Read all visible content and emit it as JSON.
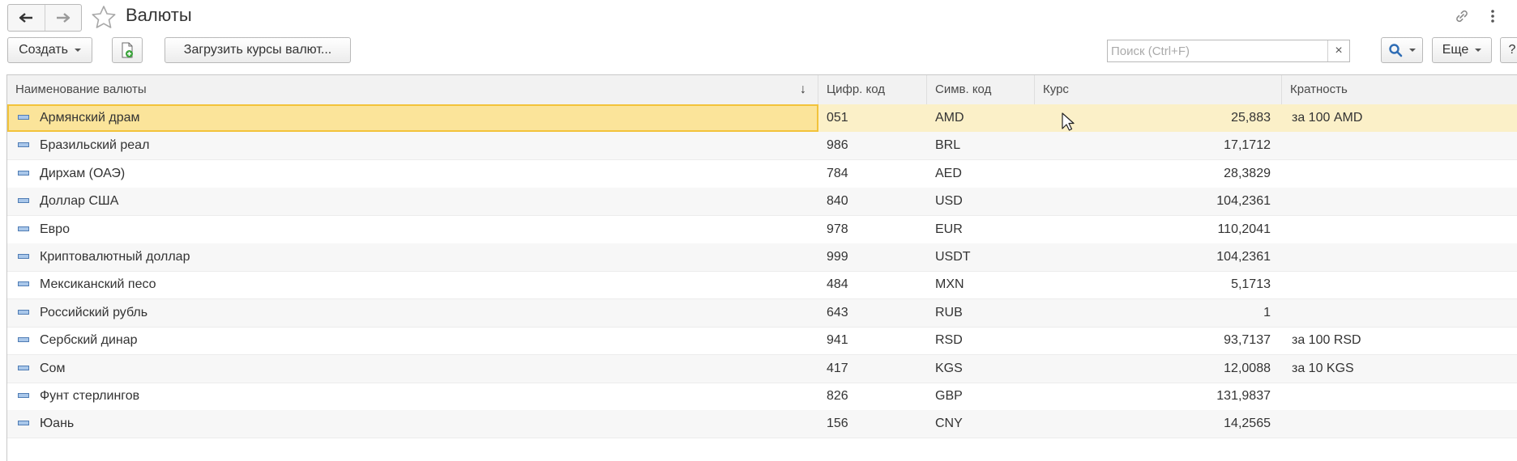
{
  "window": {
    "title": "Валюты"
  },
  "nav": {
    "back_icon": "arrow-left-icon",
    "forward_icon": "arrow-right-icon",
    "favorite_icon": "star-icon"
  },
  "header_icons": {
    "link": "link-icon",
    "more": "kebab-icon"
  },
  "toolbar": {
    "create_label": "Создать",
    "add_copy_icon": "new-document-icon",
    "load_rates_label": "Загрузить курсы валют...",
    "search_placeholder": "Поиск (Ctrl+F)",
    "search_clear": "×",
    "search_icon": "magnifier-icon",
    "more_label": "Еще",
    "help_label": "?"
  },
  "table": {
    "columns": [
      "Наименование валюты",
      "Цифр. код",
      "Симв. код",
      "Курс",
      "Кратность"
    ],
    "sort_indicator": "↓",
    "rows": [
      {
        "name": "Армянский драм",
        "num": "051",
        "sym": "AMD",
        "rate": "25,883",
        "mult": "за 100 AMD",
        "selected": true
      },
      {
        "name": "Бразильский реал",
        "num": "986",
        "sym": "BRL",
        "rate": "17,1712",
        "mult": ""
      },
      {
        "name": "Дирхам (ОАЭ)",
        "num": "784",
        "sym": "AED",
        "rate": "28,3829",
        "mult": ""
      },
      {
        "name": "Доллар США",
        "num": "840",
        "sym": "USD",
        "rate": "104,2361",
        "mult": ""
      },
      {
        "name": "Евро",
        "num": "978",
        "sym": "EUR",
        "rate": "110,2041",
        "mult": ""
      },
      {
        "name": "Криптовалютный доллар",
        "num": "999",
        "sym": "USDT",
        "rate": "104,2361",
        "mult": ""
      },
      {
        "name": "Мексиканский песо",
        "num": "484",
        "sym": "MXN",
        "rate": "5,1713",
        "mult": ""
      },
      {
        "name": "Российский рубль",
        "num": "643",
        "sym": "RUB",
        "rate": "1",
        "mult": ""
      },
      {
        "name": "Сербский динар",
        "num": "941",
        "sym": "RSD",
        "rate": "93,7137",
        "mult": "за 100 RSD"
      },
      {
        "name": "Сом",
        "num": "417",
        "sym": "KGS",
        "rate": "12,0088",
        "mult": "за 10 KGS"
      },
      {
        "name": "Фунт стерлингов",
        "num": "826",
        "sym": "GBP",
        "rate": "131,9837",
        "mult": ""
      },
      {
        "name": "Юань",
        "num": "156",
        "sym": "CNY",
        "rate": "14,2565",
        "mult": ""
      }
    ]
  },
  "colors": {
    "selected_row": "#fbf0c8",
    "selected_cell": "#fbe49a",
    "selected_border": "#f2c33a",
    "header_bg": "#f2f2f2",
    "accent_blue": "#2f6db5"
  }
}
